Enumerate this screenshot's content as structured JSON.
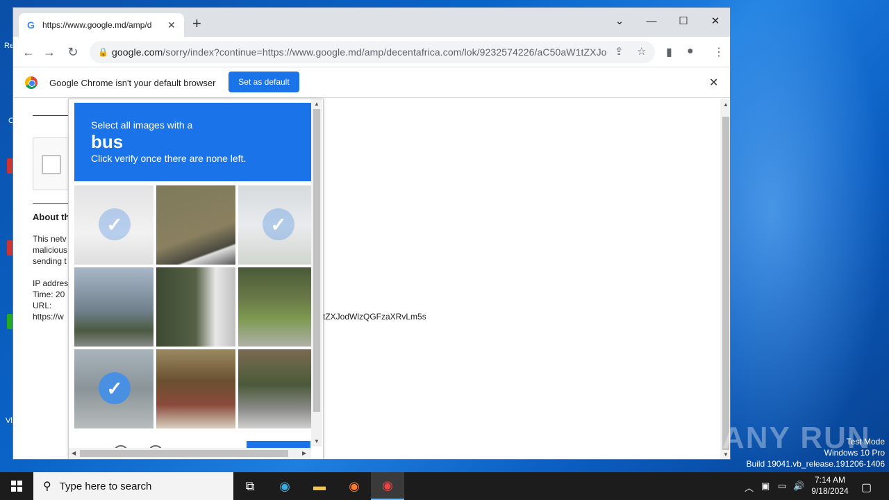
{
  "browser": {
    "tab_title": "https://www.google.md/amp/d",
    "url_domain": "google.com",
    "url_rest": "/sorry/index?continue=https://www.google.md/amp/decentafrica.com/lok/9232574226/aC50aW1tZXJo...",
    "infobar_message": "Google Chrome isn't your default browser",
    "set_default_label": "Set as default"
  },
  "page": {
    "about_heading": "About th",
    "body_lines": [
      "This netv",
      "malicious",
      "sending t"
    ],
    "ip_label": "IP addres",
    "time_label": "Time: 20",
    "url_label": "URL:",
    "url_value": "https://w",
    "url_tail": "tZXJodWlzQGFzaXRvLm5s"
  },
  "captcha": {
    "instruction": "Select all images with a",
    "target": "bus",
    "hint": "Click verify once there are none left.",
    "tiles": [
      {
        "selected": true
      },
      {
        "selected": false
      },
      {
        "selected": true
      },
      {
        "selected": false
      },
      {
        "selected": false
      },
      {
        "selected": false
      },
      {
        "selected": true
      },
      {
        "selected": false
      },
      {
        "selected": false
      }
    ]
  },
  "taskbar": {
    "search_placeholder": "Type here to search",
    "time": "7:14 AM",
    "date": "9/18/2024"
  },
  "watermark": {
    "line1": "Test Mode",
    "line2": "Windows 10 Pro",
    "line3": "Build 19041.vb_release.191206-1406",
    "brand": "ANY RUN"
  },
  "desktop": {
    "icon_labels": [
      "Re",
      "C",
      "Vl"
    ]
  },
  "colors": {
    "accent": "#1a73e8",
    "desktop": "#0a64c8",
    "taskbar": "#1c1c1c"
  }
}
